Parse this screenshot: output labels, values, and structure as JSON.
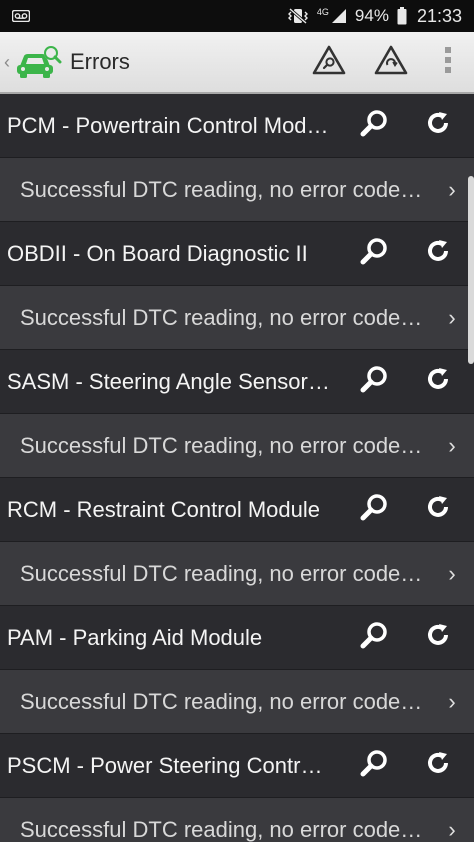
{
  "status_bar": {
    "network": "4G",
    "battery": "94%",
    "time": "21:33",
    "icons": [
      "voicemail-icon",
      "vibrate-icon",
      "signal-icon",
      "battery-icon"
    ]
  },
  "action_bar": {
    "title": "Errors",
    "icons": [
      "car-logo-icon",
      "warning-search-icon",
      "warning-clear-icon",
      "overflow-menu-icon"
    ]
  },
  "modules": [
    {
      "name": "PCM - Powertrain Control Module",
      "status": "Successful DTC reading, no error codes found"
    },
    {
      "name": "OBDII - On Board Diagnostic II",
      "status": "Successful DTC reading, no error codes found"
    },
    {
      "name": "SASM - Steering Angle Sensor Module",
      "status": "Successful DTC reading, no error codes found"
    },
    {
      "name": "RCM - Restraint Control Module",
      "status": "Successful DTC reading, no error codes found"
    },
    {
      "name": "PAM - Parking Aid Module",
      "status": "Successful DTC reading, no error codes found"
    },
    {
      "name": "PSCM - Power Steering Control Module",
      "status": "Successful DTC reading, no error codes found"
    }
  ],
  "colors": {
    "accent": "#3cb54a",
    "row": "#2b2b2f",
    "status_row": "#3a3a3e"
  }
}
